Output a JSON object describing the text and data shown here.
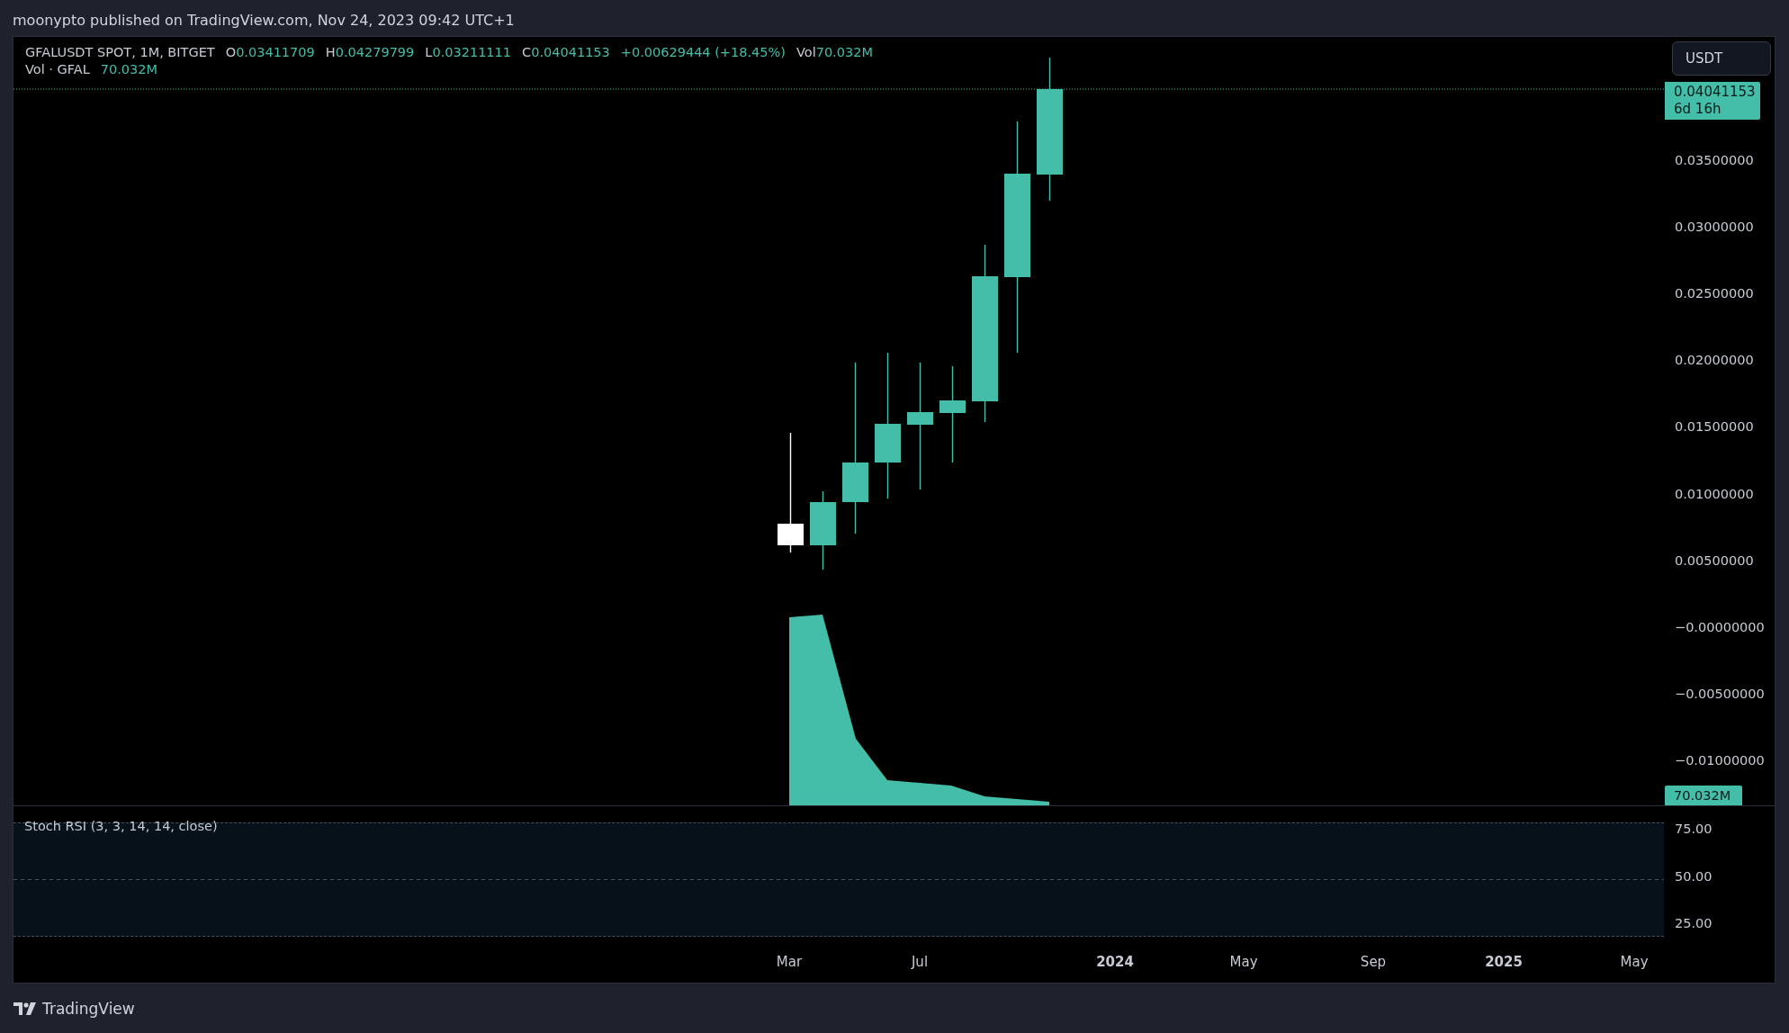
{
  "header": {
    "text": "moonypto published on TradingView.com, Nov 24, 2023 09:42 UTC+1"
  },
  "legend": {
    "symbol": "GFALUSDT SPOT, 1M, BITGET",
    "ohlc": [
      {
        "key": "O",
        "value": "0.03411709"
      },
      {
        "key": "H",
        "value": "0.04279799"
      },
      {
        "key": "L",
        "value": "0.03211111"
      },
      {
        "key": "C",
        "value": "0.04041153"
      }
    ],
    "change": "+0.00629444 (+18.45%)",
    "volume": {
      "key": "Vol",
      "value": "70.032M"
    }
  },
  "volume_legend": {
    "label": "Vol · GFAL",
    "value": "70.032M"
  },
  "currency_button": "USDT",
  "last_price": {
    "price": "0.04041153",
    "countdown": "6d 16h"
  },
  "price_axis": [
    "0.03500000",
    "0.03000000",
    "0.02500000",
    "0.02000000",
    "0.01500000",
    "0.01000000",
    "0.00500000",
    "−0.00000000",
    "−0.00500000",
    "−0.01000000"
  ],
  "volume_badge": "70.032M",
  "stoch_rsi": {
    "title": "Stoch RSI (3, 3, 14, 14, close)",
    "axis": [
      "75.00",
      "50.00",
      "25.00"
    ]
  },
  "time_axis": [
    {
      "label": "Mar",
      "bold": false
    },
    {
      "label": "Jul",
      "bold": false
    },
    {
      "label": "2024",
      "bold": true
    },
    {
      "label": "May",
      "bold": false
    },
    {
      "label": "Sep",
      "bold": false
    },
    {
      "label": "2025",
      "bold": true
    },
    {
      "label": "May",
      "bold": false
    }
  ],
  "footer": {
    "brand": "TradingView"
  }
}
